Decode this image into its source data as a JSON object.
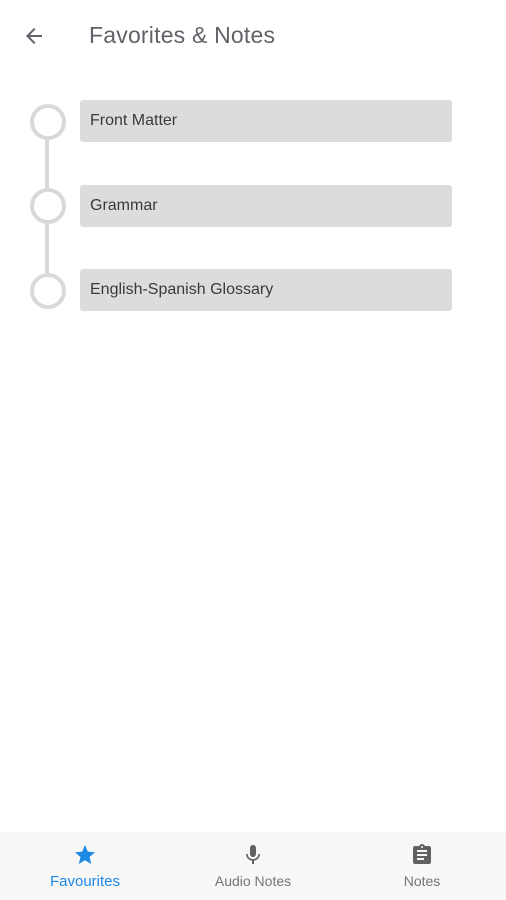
{
  "header": {
    "title": "Favorites & Notes",
    "back_icon": "arrow-left-icon"
  },
  "favorites": [
    {
      "label": "Front Matter"
    },
    {
      "label": "Grammar"
    },
    {
      "label": "English-Spanish Glossary"
    }
  ],
  "bottom_nav": {
    "tabs": [
      {
        "label": "Favourites",
        "icon": "star-icon",
        "active": true
      },
      {
        "label": "Audio Notes",
        "icon": "microphone-icon",
        "active": false
      },
      {
        "label": "Notes",
        "icon": "clipboard-icon",
        "active": false
      }
    ]
  },
  "colors": {
    "accent": "#1e88e5",
    "inactive": "#757575",
    "card_bg": "#dcdcdc",
    "timeline": "#d9d9d9"
  }
}
